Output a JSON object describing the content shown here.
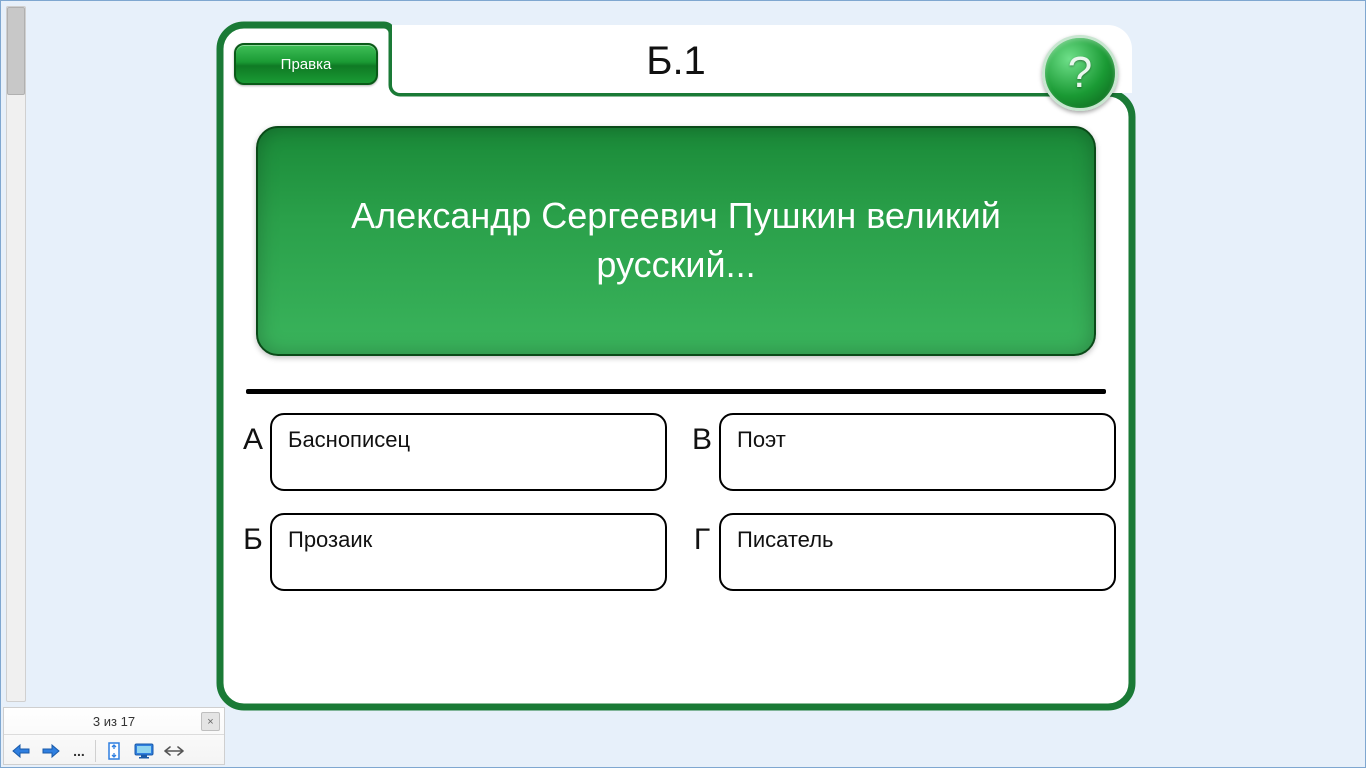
{
  "header": {
    "title": "Б.1",
    "edit_label": "Правка",
    "help_label": "?"
  },
  "question": {
    "text": "Александр Сергеевич Пушкин великий русский..."
  },
  "answers": [
    {
      "letter": "А",
      "text": "Баснописец"
    },
    {
      "letter": "В",
      "text": "Поэт"
    },
    {
      "letter": "Б",
      "text": "Прозаик"
    },
    {
      "letter": "Г",
      "text": "Писатель"
    }
  ],
  "toolbar": {
    "page_indicator": "3 из 17",
    "close": "×",
    "more": "..."
  },
  "colors": {
    "bg": "#e7f0fa",
    "green_dark": "#1a7a36",
    "green_light": "#3ab45c"
  }
}
